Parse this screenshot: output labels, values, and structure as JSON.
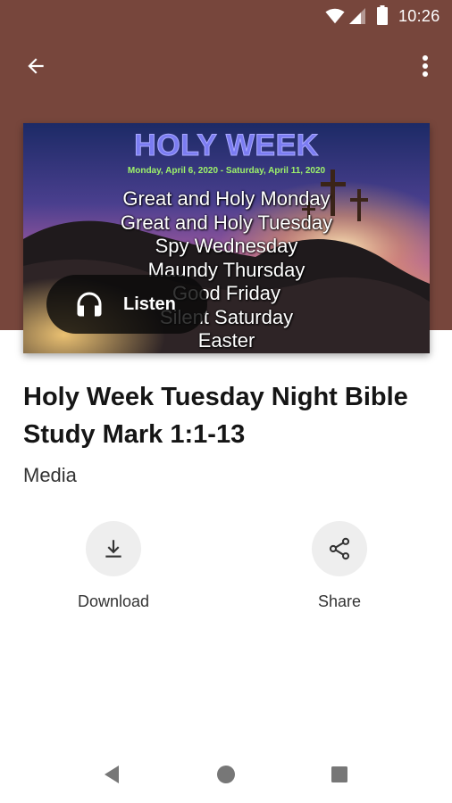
{
  "status_bar": {
    "time": "10:26"
  },
  "artwork": {
    "heading": "HOLY WEEK",
    "dates": "Monday, April 6, 2020 - Saturday, April 11, 2020",
    "days": [
      "Great and Holy Monday",
      "Great and Holy Tuesday",
      "Spy Wednesday",
      "Maundy Thursday",
      "Good Friday",
      "Silent Saturday",
      "Easter"
    ]
  },
  "listen": {
    "label": "Listen"
  },
  "content": {
    "title": "Holy Week Tuesday Night Bible Study Mark 1:1-13",
    "subtitle": "Media"
  },
  "actions": {
    "download_label": "Download",
    "share_label": "Share"
  },
  "colors": {
    "header": "#77463c",
    "action_circle": "#eeeeee"
  }
}
